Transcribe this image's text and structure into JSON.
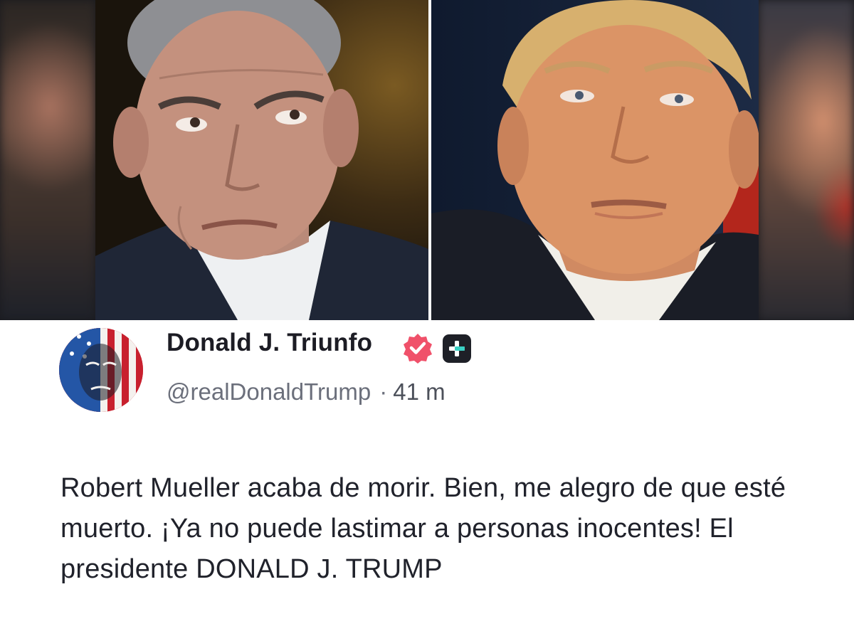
{
  "post": {
    "images": {
      "left_icon": "portrait-photo-icon",
      "right_icon": "portrait-photo-icon"
    },
    "author": {
      "display_name": "Donald J. Triunfo",
      "handle": "@realDonaldTrump",
      "separator": "·",
      "timestamp": "41 m",
      "avatar_icon": "flag-face-avatar-icon",
      "verified_icon": "verified-badge-icon",
      "plus_icon": "plus-badge-icon"
    },
    "body": "Robert Mueller acaba de morir. Bien, me alegro de que esté muerto. ¡Ya no puede lastimar a personas inocentes! El presidente DONALD J. TRUMP"
  },
  "colors": {
    "verified_badge": "#f0516a",
    "plus_badge": "#1e2027",
    "plus_accent": "#3ad1c4",
    "text": "#20222b",
    "muted": "#6b6f7b"
  }
}
